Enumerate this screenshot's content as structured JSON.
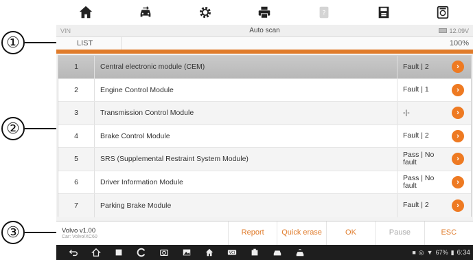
{
  "callouts": [
    "①",
    "②",
    "③"
  ],
  "toolbar": {
    "icons": [
      "home-icon",
      "vehicle-swap-icon",
      "settings-gear-icon",
      "printer-icon",
      "help-icon",
      "save-icon",
      "vci-icon"
    ]
  },
  "status": {
    "vin_label": "VIN",
    "title": "Auto scan",
    "voltage": "12.09V"
  },
  "list_bar": {
    "label": "LIST",
    "progress_text": "100%",
    "progress_fraction": 1.0
  },
  "modules": [
    {
      "index": "1",
      "name": "Central electronic module (CEM)",
      "status": "Fault | 2"
    },
    {
      "index": "2",
      "name": "Engine Control Module",
      "status": "Fault | 1"
    },
    {
      "index": "3",
      "name": "Transmission Control Module",
      "status": "-|-"
    },
    {
      "index": "4",
      "name": "Brake Control Module",
      "status": "Fault | 2"
    },
    {
      "index": "5",
      "name": "SRS (Supplemental Restraint System Module)",
      "status": "Pass | No fault"
    },
    {
      "index": "6",
      "name": "Driver Information Module",
      "status": "Pass | No fault"
    },
    {
      "index": "7",
      "name": "Parking Brake Module",
      "status": "Fault | 2"
    }
  ],
  "bottom": {
    "vehicle_name": "Volvo v1.00",
    "vehicle_sub": "Car: Volvo/XC60",
    "report": "Report",
    "quick_erase": "Quick erase",
    "ok": "OK",
    "pause": "Pause",
    "esc": "ESC"
  },
  "system_tray": {
    "battery": "67%",
    "time": "6:34"
  },
  "colors": {
    "accent": "#ee7a22",
    "nav_bar": "#1e1e1e"
  }
}
